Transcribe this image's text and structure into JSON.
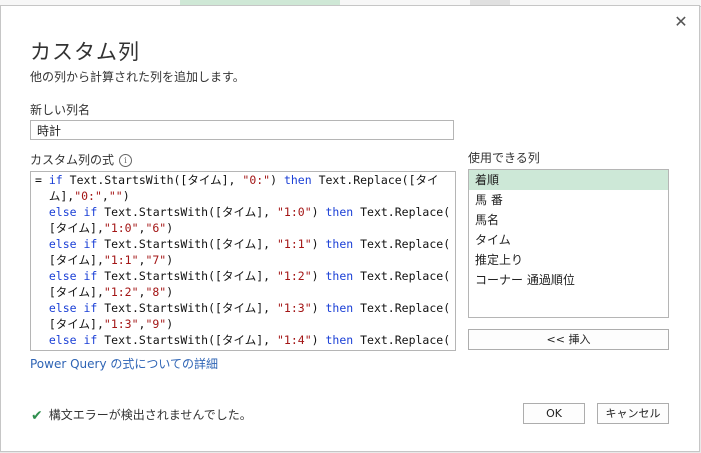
{
  "dialog": {
    "title": "カスタム列",
    "description": "他の列から計算された列を追加します。",
    "close_icon": "close-icon"
  },
  "new_column": {
    "label": "新しい列名",
    "value": "時計"
  },
  "formula": {
    "label": "カスタム列の式",
    "info_icon": "info-icon",
    "lines": [
      [
        {
          "t": "= "
        },
        {
          "t": "if",
          "c": "kw"
        },
        {
          "t": " Text.StartsWith([タイム], "
        },
        {
          "t": "\"0:\"",
          "c": "str"
        },
        {
          "t": ") "
        },
        {
          "t": "then",
          "c": "kw"
        },
        {
          "t": " Text.Replace([タイ"
        }
      ],
      [
        {
          "t": "  ム],"
        },
        {
          "t": "\"0:\"",
          "c": "str"
        },
        {
          "t": ","
        },
        {
          "t": "\"\"",
          "c": "str"
        },
        {
          "t": ")"
        }
      ],
      [
        {
          "t": "  "
        },
        {
          "t": "else if",
          "c": "kw"
        },
        {
          "t": " Text.StartsWith([タイム], "
        },
        {
          "t": "\"1:0\"",
          "c": "str"
        },
        {
          "t": ") "
        },
        {
          "t": "then",
          "c": "kw"
        },
        {
          "t": " Text.Replace("
        }
      ],
      [
        {
          "t": "  [タイム],"
        },
        {
          "t": "\"1:0\"",
          "c": "str"
        },
        {
          "t": ","
        },
        {
          "t": "\"6\"",
          "c": "str"
        },
        {
          "t": ")"
        }
      ],
      [
        {
          "t": "  "
        },
        {
          "t": "else if",
          "c": "kw"
        },
        {
          "t": " Text.StartsWith([タイム], "
        },
        {
          "t": "\"1:1\"",
          "c": "str"
        },
        {
          "t": ") "
        },
        {
          "t": "then",
          "c": "kw"
        },
        {
          "t": " Text.Replace("
        }
      ],
      [
        {
          "t": "  [タイム],"
        },
        {
          "t": "\"1:1\"",
          "c": "str"
        },
        {
          "t": ","
        },
        {
          "t": "\"7\"",
          "c": "str"
        },
        {
          "t": ")"
        }
      ],
      [
        {
          "t": "  "
        },
        {
          "t": "else if",
          "c": "kw"
        },
        {
          "t": " Text.StartsWith([タイム], "
        },
        {
          "t": "\"1:2\"",
          "c": "str"
        },
        {
          "t": ") "
        },
        {
          "t": "then",
          "c": "kw"
        },
        {
          "t": " Text.Replace("
        }
      ],
      [
        {
          "t": "  [タイム],"
        },
        {
          "t": "\"1:2\"",
          "c": "str"
        },
        {
          "t": ","
        },
        {
          "t": "\"8\"",
          "c": "str"
        },
        {
          "t": ")"
        }
      ],
      [
        {
          "t": "  "
        },
        {
          "t": "else if",
          "c": "kw"
        },
        {
          "t": " Text.StartsWith([タイム], "
        },
        {
          "t": "\"1:3\"",
          "c": "str"
        },
        {
          "t": ") "
        },
        {
          "t": "then",
          "c": "kw"
        },
        {
          "t": " Text.Replace("
        }
      ],
      [
        {
          "t": "  [タイム],"
        },
        {
          "t": "\"1:3\"",
          "c": "str"
        },
        {
          "t": ","
        },
        {
          "t": "\"9\"",
          "c": "str"
        },
        {
          "t": ")"
        }
      ],
      [
        {
          "t": "  "
        },
        {
          "t": "else if",
          "c": "kw"
        },
        {
          "t": " Text.StartsWith([タイム], "
        },
        {
          "t": "\"1:4\"",
          "c": "str"
        },
        {
          "t": ") "
        },
        {
          "t": "then",
          "c": "kw"
        },
        {
          "t": " Text.Replace("
        }
      ]
    ]
  },
  "learn_more_link": "Power Query の式についての詳細",
  "available_columns": {
    "label": "使用できる列",
    "items": [
      "着順",
      "馬 番",
      "馬名",
      "タイム",
      "推定上り",
      "コーナー 通過順位"
    ],
    "selected_index": 0
  },
  "insert_button": "<< 挿入",
  "status": {
    "icon": "check-icon",
    "text": "構文エラーが検出されませんでした。"
  },
  "ok_button": "OK",
  "cancel_button": "キャンセル",
  "colors": {
    "selected_bg": "#cde8d7",
    "keyword": "#1a3fd6",
    "string": "#a31515",
    "link": "#2e64b5",
    "success": "#2f8f4e"
  }
}
